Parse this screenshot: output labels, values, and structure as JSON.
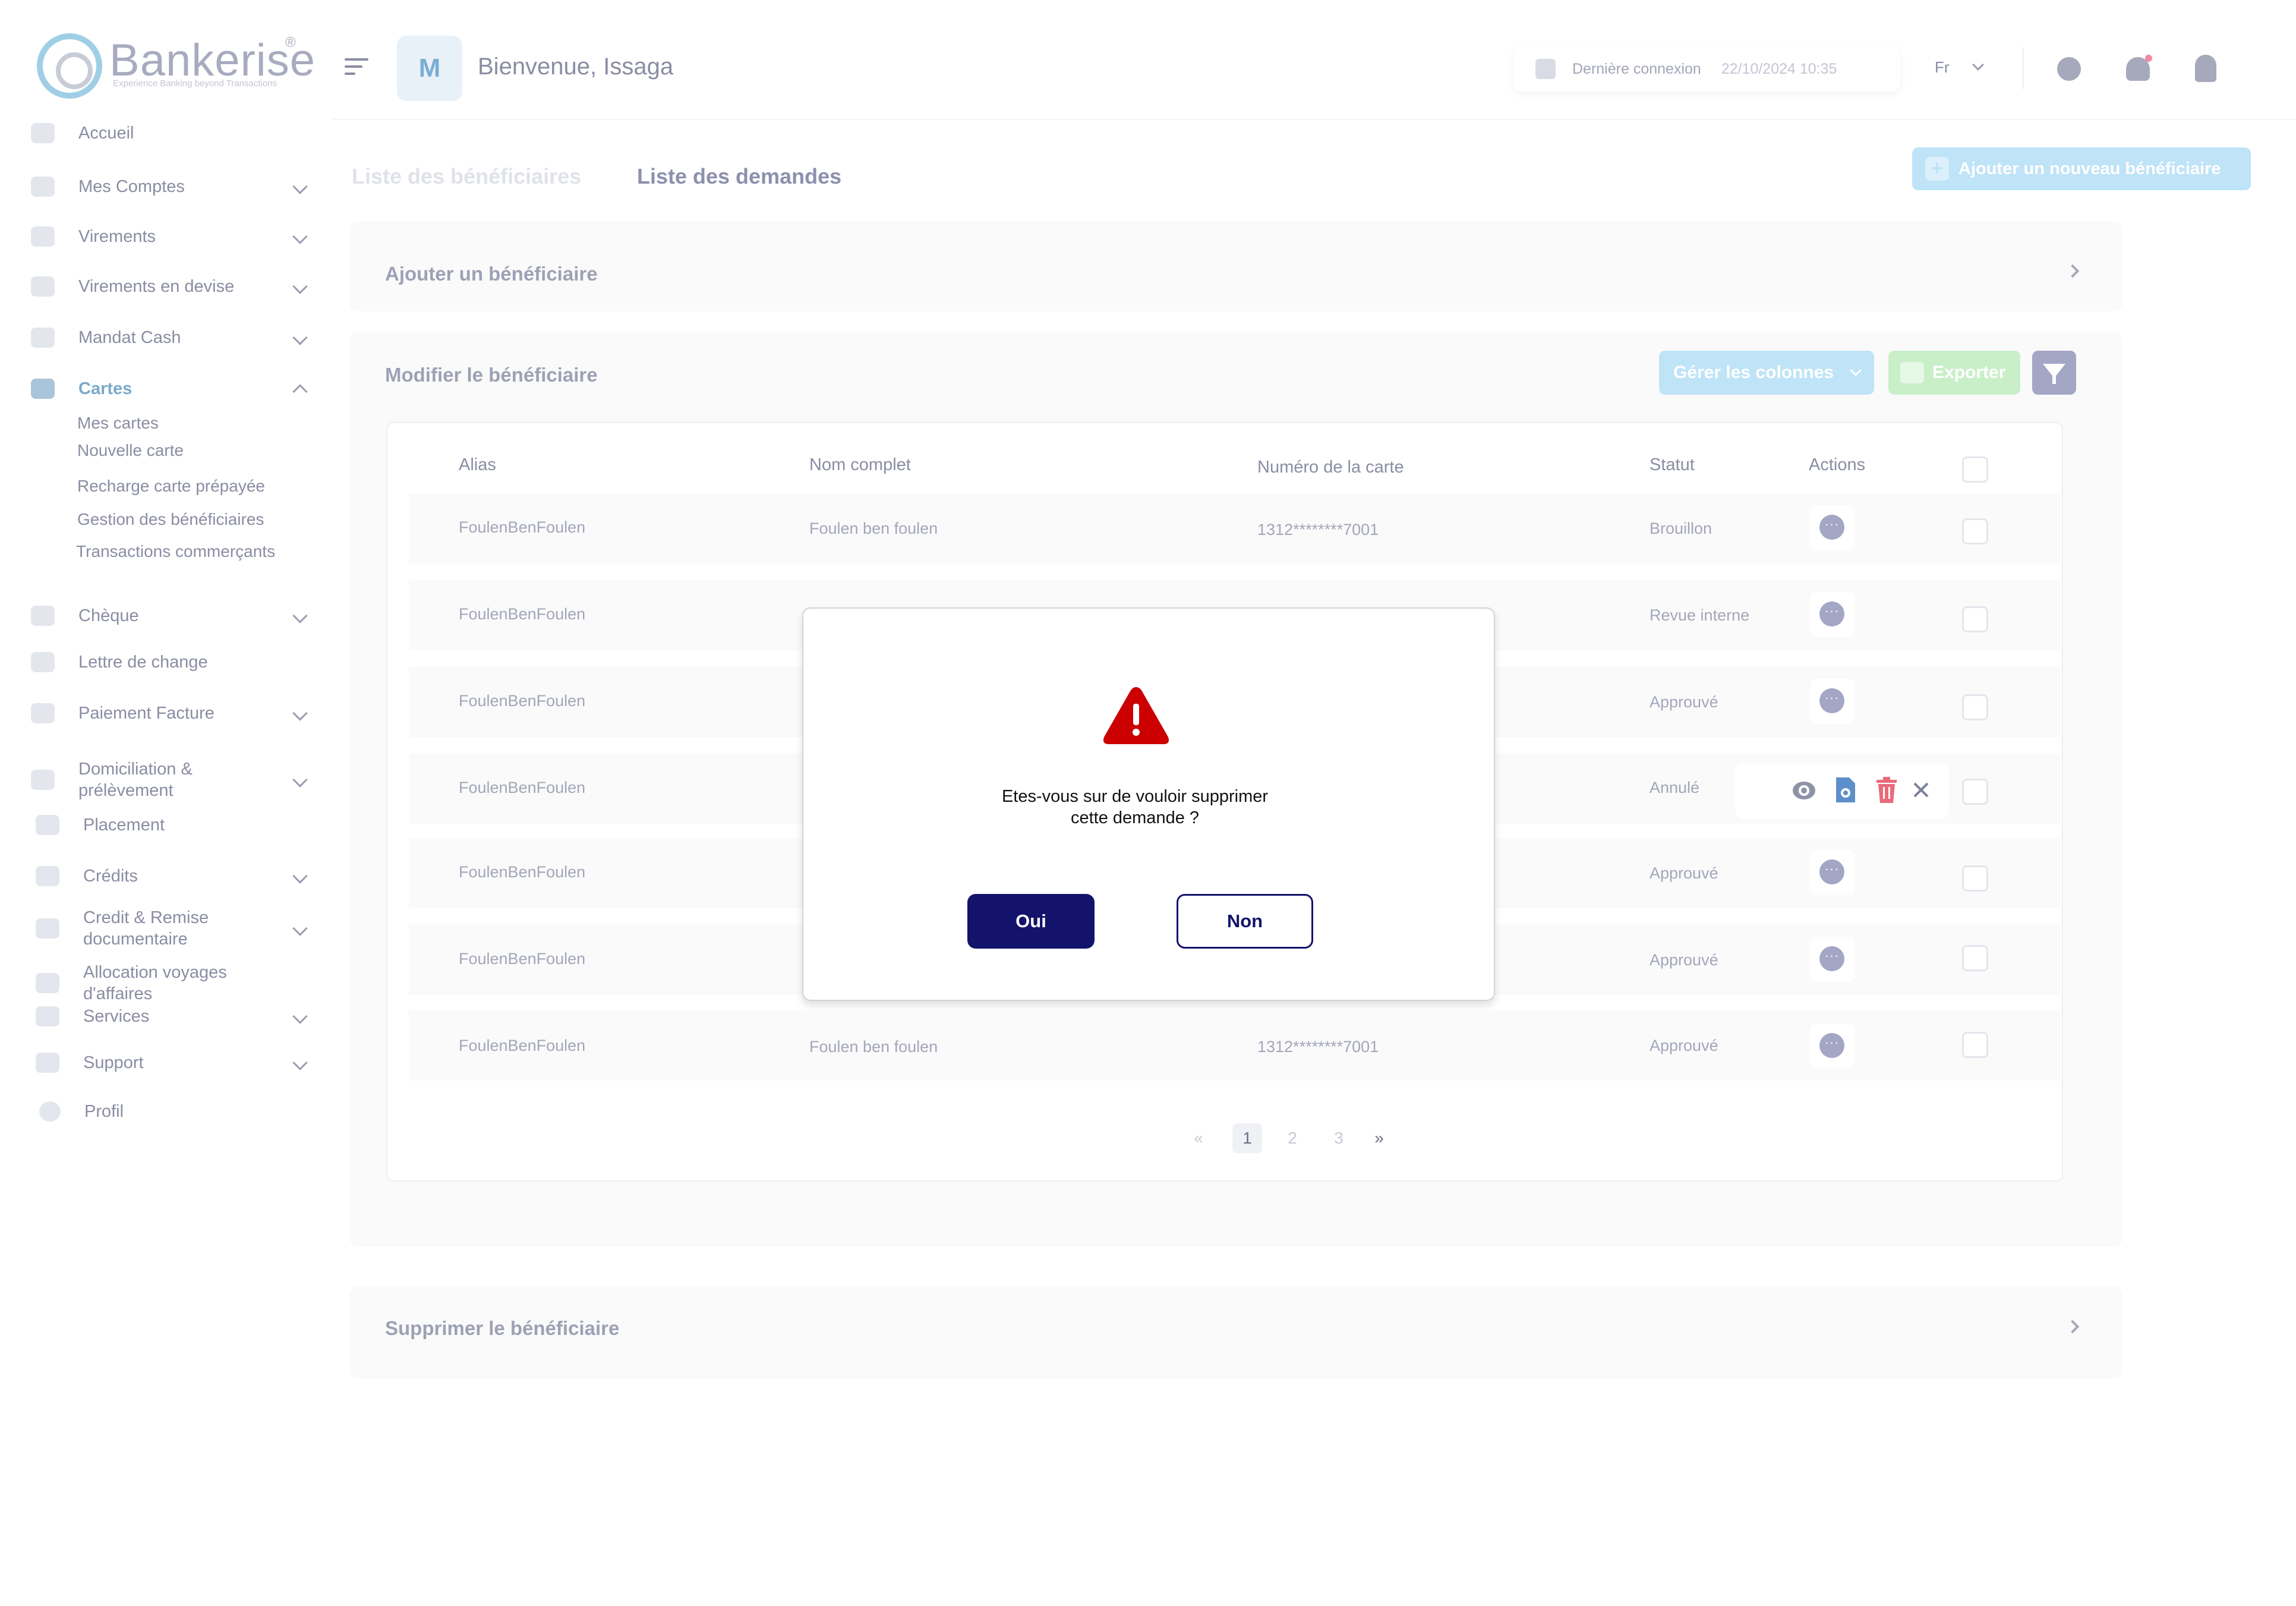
{
  "brand": {
    "name": "Bankerise",
    "reg": "®",
    "tagline": "Experience Banking beyond Transactions"
  },
  "header": {
    "avatar_initial": "M",
    "welcome": "Bienvenue, Issaga",
    "last_login_label": "Dernière  connexion",
    "last_login_value": "22/10/2024 10:35",
    "language": "Fr"
  },
  "sidebar": {
    "items": [
      {
        "label": "Accueil"
      },
      {
        "label": "Mes Comptes"
      },
      {
        "label": "Virements"
      },
      {
        "label": "Virements en devise"
      },
      {
        "label": "Mandat Cash"
      },
      {
        "label": "Cartes"
      },
      {
        "label": "Chèque"
      },
      {
        "label": "Lettre de change"
      },
      {
        "label": "Paiement Facture"
      },
      {
        "label": "Domiciliation &\nprélèvement"
      },
      {
        "label": "Placement"
      },
      {
        "label": "Crédits"
      },
      {
        "label": "Credit & Remise\ndocumentaire"
      },
      {
        "label": "Allocation  voyages\nd'affaires"
      },
      {
        "label": "Services"
      },
      {
        "label": "Support"
      },
      {
        "label": "Profil"
      }
    ],
    "cartes_sub": [
      "Mes cartes",
      "Nouvelle carte",
      "Recharge carte prépayée",
      "Gestion des bénéficiaires",
      "Transactions commerçants"
    ]
  },
  "tabs": {
    "list_beneficiaires": "Liste des bénéficiaires",
    "list_demandes": "Liste des demandes"
  },
  "add_new_button": "Ajouter un nouveau bénéficiaire",
  "sections": {
    "add": "Ajouter un bénéficiaire",
    "edit": "Modifier le bénéficiaire",
    "delete": "Supprimer le bénéficiaire"
  },
  "toolbar": {
    "columns": "Gérer les colonnes",
    "export": "Exporter"
  },
  "table": {
    "headers": {
      "alias": "Alias",
      "nom": "Nom complet",
      "numero": "Numéro de la carte",
      "statut": "Statut",
      "actions": "Actions"
    },
    "rows": [
      {
        "alias": "FoulenBenFoulen",
        "nom": "Foulen ben foulen",
        "numero": "1312********7001",
        "statut": "Brouillon"
      },
      {
        "alias": "FoulenBenFoulen",
        "nom": "",
        "numero": "",
        "statut": "Revue interne"
      },
      {
        "alias": "FoulenBenFoulen",
        "nom": "",
        "numero": "",
        "statut": "Approuvé"
      },
      {
        "alias": "FoulenBenFoulen",
        "nom": "",
        "numero": "",
        "statut": "Annulé"
      },
      {
        "alias": "FoulenBenFoulen",
        "nom": "",
        "numero": "",
        "statut": "Approuvé"
      },
      {
        "alias": "FoulenBenFoulen",
        "nom": "",
        "numero": "",
        "statut": "Approuvé"
      },
      {
        "alias": "FoulenBenFoulen",
        "nom": "Foulen ben foulen",
        "numero": "1312********7001",
        "statut": "Approuvé"
      }
    ],
    "action_dots": "···"
  },
  "pagination": {
    "first": "«",
    "pages": [
      "1",
      "2",
      "3"
    ],
    "next": "»",
    "current": "1"
  },
  "modal": {
    "message": "Etes-vous sur de vouloir  supprimer\ncette demande  ?",
    "yes": "Oui",
    "no": "Non"
  },
  "colors": {
    "brand_navy": "#13136b",
    "warning_red": "#cc0000",
    "accent_blue": "#bfe3f7",
    "export_green": "#c9efc9"
  }
}
